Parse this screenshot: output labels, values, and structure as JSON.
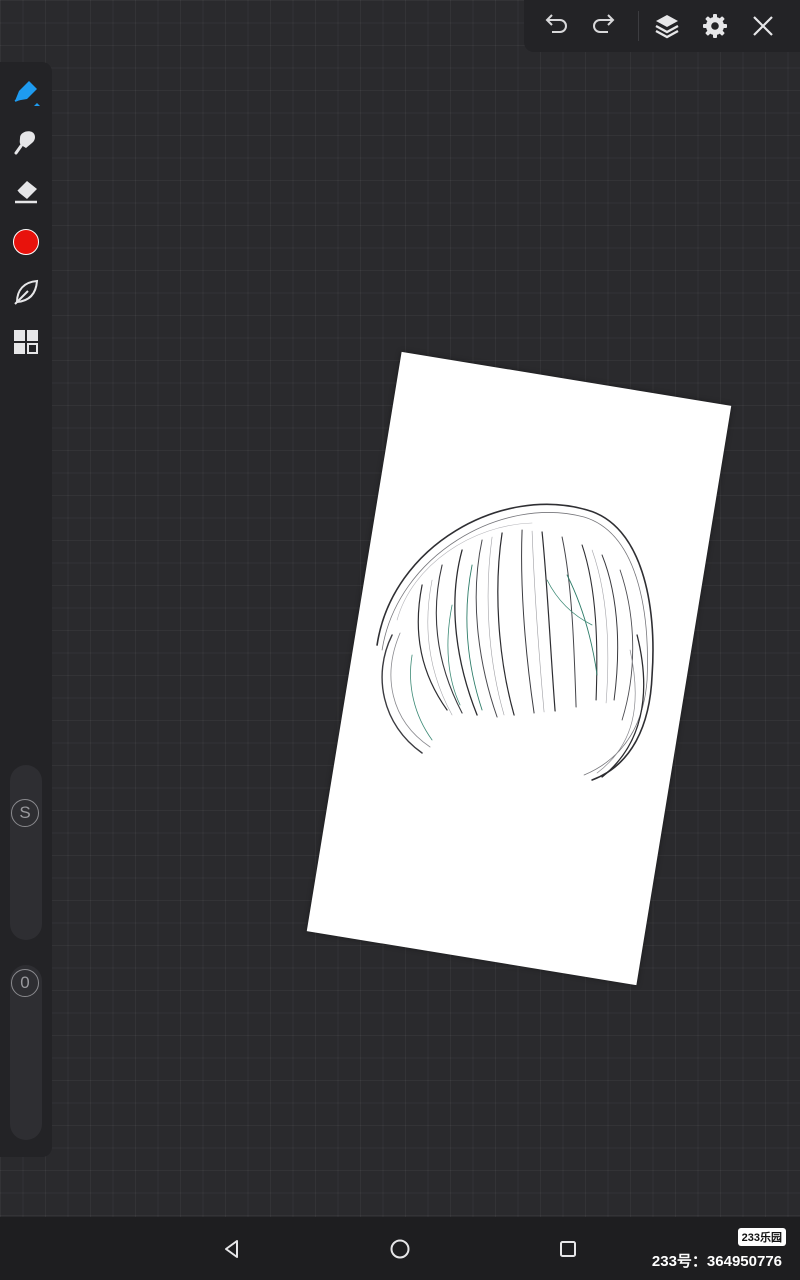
{
  "top_toolbar": {
    "buttons": [
      {
        "name": "undo",
        "icon": "undo-icon"
      },
      {
        "name": "redo",
        "icon": "redo-icon"
      },
      {
        "name": "layers",
        "icon": "layers-icon"
      },
      {
        "name": "settings",
        "icon": "gear-icon"
      },
      {
        "name": "close",
        "icon": "close-icon"
      }
    ]
  },
  "left_toolbar": {
    "tools": [
      {
        "name": "pen",
        "icon": "pen-icon",
        "active": true
      },
      {
        "name": "smudge",
        "icon": "smudge-icon"
      },
      {
        "name": "eraser",
        "icon": "eraser-icon"
      },
      {
        "name": "color",
        "icon": "color-swatch",
        "color": "#e8120c"
      },
      {
        "name": "lasso",
        "icon": "lasso-leaf-icon"
      },
      {
        "name": "more",
        "icon": "grid-icon"
      }
    ],
    "sliders": {
      "size_label": "S",
      "opacity_label": "0"
    }
  },
  "canvas": {
    "artwork": "hair sketch"
  },
  "nav": {
    "buttons": [
      {
        "name": "back",
        "icon": "back-triangle-icon"
      },
      {
        "name": "home",
        "icon": "home-circle-icon"
      },
      {
        "name": "recents",
        "icon": "recents-square-icon"
      }
    ]
  },
  "watermark": {
    "logo_text": "233乐园",
    "id_text": "233号：364950776"
  },
  "colors": {
    "accent": "#1e9bf0",
    "active_color": "#e8120c",
    "background": "#2a2a2d",
    "toolbar": "#232326"
  }
}
